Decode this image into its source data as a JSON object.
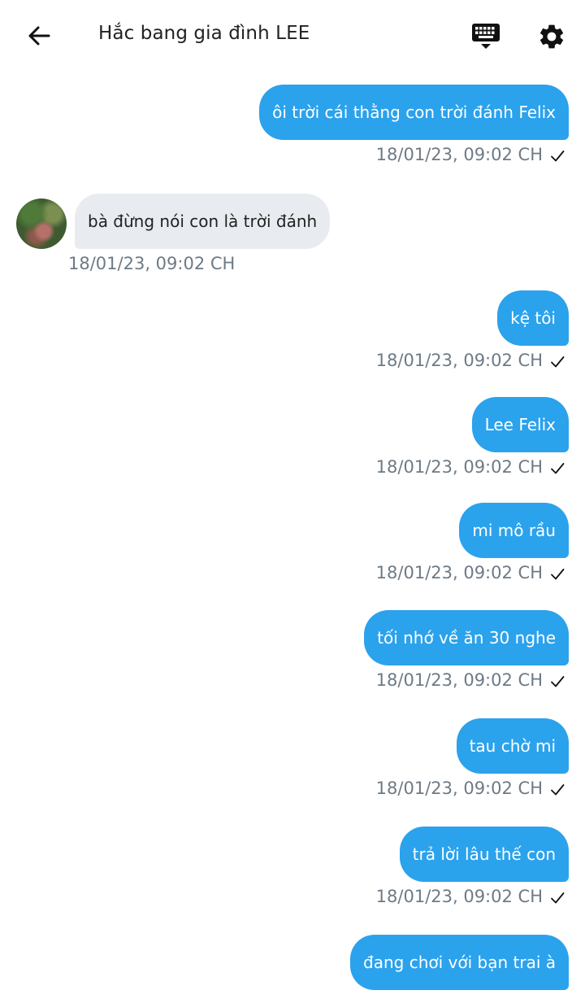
{
  "header": {
    "title": "Hắc bang gia đình LEE",
    "icons": {
      "back": "arrow-left-icon",
      "keyboard": "keyboard-icon",
      "settings": "gear-icon"
    }
  },
  "colors": {
    "outgoing_bubble": "#2ba2ec",
    "incoming_bubble": "#e8ecf0",
    "timestamp": "#6e7a85"
  },
  "messages": [
    {
      "direction": "out",
      "text": "ôi trời cái thằng con trời đánh Felix",
      "time": "18/01/23,  09:02 CH",
      "status": "check-icon"
    },
    {
      "direction": "in",
      "text": "bà đừng nói con là trời đánh",
      "time": "18/01/23,  09:02 CH"
    },
    {
      "direction": "out",
      "text": "kệ tôi",
      "time": "18/01/23,  09:02 CH",
      "status": "check-icon"
    },
    {
      "direction": "out",
      "text": "Lee Felix",
      "time": "18/01/23,  09:02 CH",
      "status": "check-icon"
    },
    {
      "direction": "out",
      "text": "mi mô rầu",
      "time": "18/01/23,  09:02 CH",
      "status": "check-icon"
    },
    {
      "direction": "out",
      "text": "tối nhớ về ăn 30 nghe",
      "time": "18/01/23,  09:02 CH",
      "status": "check-icon"
    },
    {
      "direction": "out",
      "text": "tau chờ mi",
      "time": "18/01/23,  09:02 CH",
      "status": "check-icon"
    },
    {
      "direction": "out",
      "text": "trả lời lâu thế con",
      "time": "18/01/23,  09:02 CH",
      "status": "check-icon"
    },
    {
      "direction": "out",
      "text": "đang chơi với bạn trai à"
    }
  ]
}
